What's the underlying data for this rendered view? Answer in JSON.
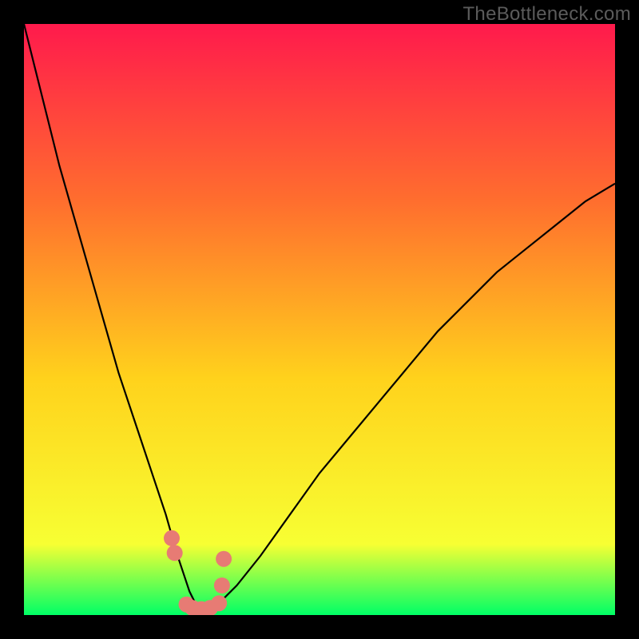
{
  "watermark": "TheBottleneck.com",
  "colors": {
    "frame": "#000000",
    "gradient_top": "#ff1a4c",
    "gradient_mid1": "#ff6e2e",
    "gradient_mid2": "#ffd21c",
    "gradient_mid3": "#f7ff33",
    "gradient_bottom": "#00ff66",
    "curve": "#000000",
    "marker": "#e77b74"
  },
  "chart_data": {
    "type": "line",
    "title": "",
    "xlabel": "",
    "ylabel": "",
    "xlim": [
      0,
      100
    ],
    "ylim": [
      0,
      100
    ],
    "series": [
      {
        "name": "bottleneck-curve",
        "x": [
          0,
          2,
          4,
          6,
          8,
          10,
          12,
          14,
          16,
          18,
          20,
          22,
          24,
          26,
          27,
          28,
          29,
          30,
          31,
          32,
          33,
          34,
          36,
          40,
          45,
          50,
          55,
          60,
          65,
          70,
          75,
          80,
          85,
          90,
          95,
          100
        ],
        "y": [
          100,
          92,
          84,
          76,
          69,
          62,
          55,
          48,
          41,
          35,
          29,
          23,
          17,
          10,
          7,
          4,
          2,
          1,
          1,
          1,
          2,
          3,
          5,
          10,
          17,
          24,
          30,
          36,
          42,
          48,
          53,
          58,
          62,
          66,
          70,
          73
        ]
      }
    ],
    "markers": {
      "name": "highlighted-points",
      "x": [
        25.0,
        25.5,
        27.5,
        28.5,
        30.0,
        31.5,
        33.0,
        33.5,
        33.8
      ],
      "y": [
        13.0,
        10.5,
        1.8,
        1.2,
        1.0,
        1.2,
        2.0,
        5.0,
        9.5
      ]
    }
  }
}
